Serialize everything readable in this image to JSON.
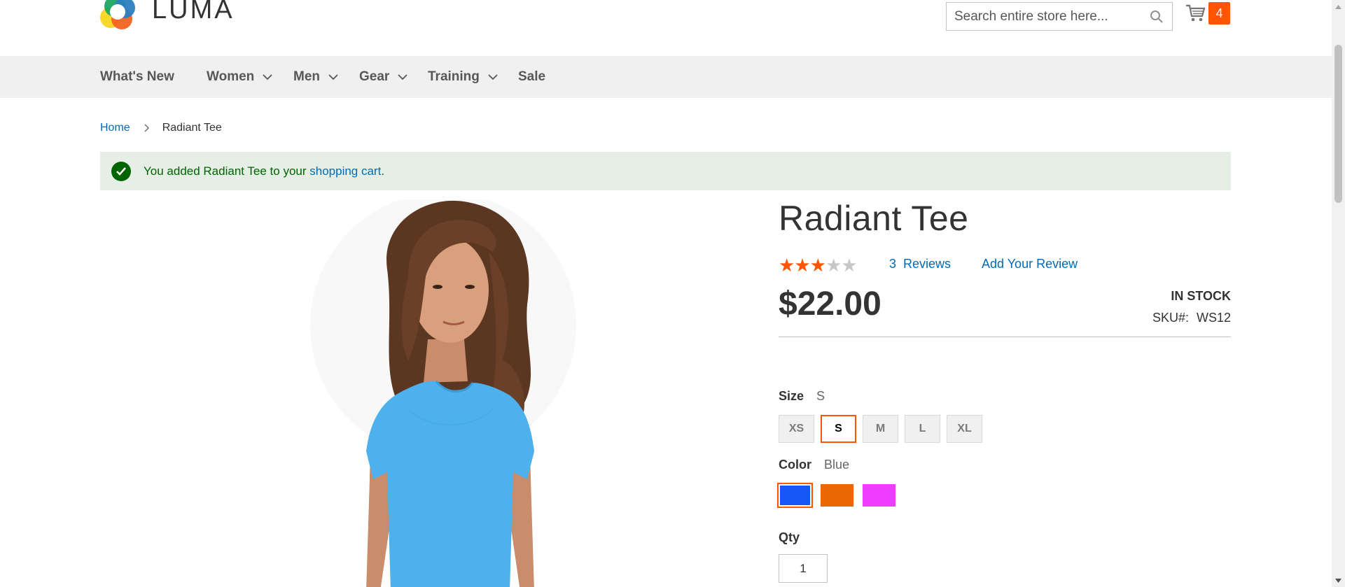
{
  "header": {
    "logo_text": "LUMA",
    "search_placeholder": "Search entire store here...",
    "cart_count": "4"
  },
  "nav": {
    "items": [
      {
        "label": "What's New",
        "has_dropdown": false
      },
      {
        "label": "Women",
        "has_dropdown": true
      },
      {
        "label": "Men",
        "has_dropdown": true
      },
      {
        "label": "Gear",
        "has_dropdown": true
      },
      {
        "label": "Training",
        "has_dropdown": true
      },
      {
        "label": "Sale",
        "has_dropdown": false
      }
    ]
  },
  "breadcrumb": {
    "home": "Home",
    "current": "Radiant Tee"
  },
  "message": {
    "prefix": "You added Radiant Tee to your ",
    "link": "shopping cart",
    "suffix": "."
  },
  "product": {
    "title": "Radiant Tee",
    "rating_stars": 3,
    "rating_max": 5,
    "reviews_count": "3",
    "reviews_label": "Reviews",
    "add_review": "Add Your Review",
    "price": "$22.00",
    "stock": "IN STOCK",
    "sku_label": "SKU#:",
    "sku_value": "WS12",
    "size": {
      "label": "Size",
      "selected": "S",
      "options": [
        "XS",
        "S",
        "M",
        "L",
        "XL"
      ]
    },
    "color": {
      "label": "Color",
      "selected": "Blue",
      "options": [
        {
          "name": "Blue",
          "hex": "#1857f7"
        },
        {
          "name": "Orange",
          "hex": "#eb6703"
        },
        {
          "name": "Purple",
          "hex": "#ef3dff"
        }
      ]
    },
    "qty": {
      "label": "Qty",
      "value": "1"
    }
  },
  "colors": {
    "accent": "#ff5501",
    "link": "#006bb4",
    "nav_bg": "#f0f0f0",
    "success_bg": "#e5efe5",
    "success_text": "#006400"
  },
  "icons": {
    "search": "search-icon",
    "cart": "cart-icon",
    "chevron": "chevron-down-icon",
    "check": "check-icon"
  }
}
